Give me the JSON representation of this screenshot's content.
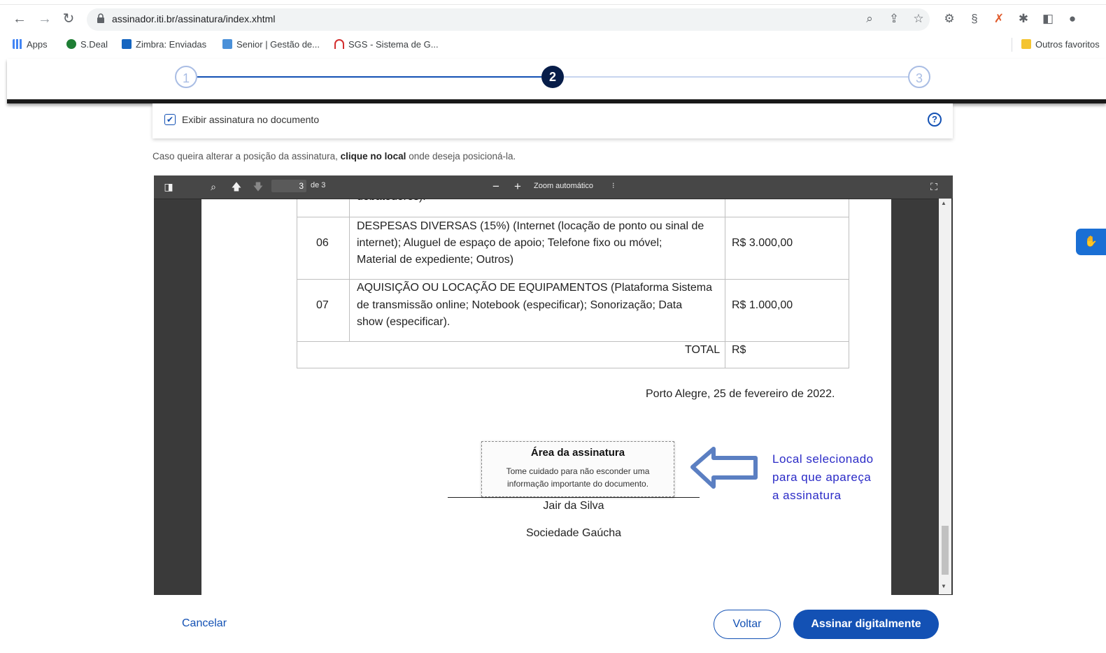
{
  "browser": {
    "url": "assinador.iti.br/assinatura/index.xhtml",
    "bookmarks": [
      {
        "label": "Apps",
        "color": "#4285f4"
      },
      {
        "label": "S.Deal",
        "color": "#1e7e34"
      },
      {
        "label": "Zimbra: Enviadas",
        "color": "#1565c0"
      },
      {
        "label": "Senior | Gestão de...",
        "color": "#4a90d9"
      },
      {
        "label": "SGS - Sistema de G...",
        "color": "#d32f2f"
      }
    ],
    "other_bookmarks": "Outros favoritos"
  },
  "stepper": {
    "steps": [
      "1",
      "2",
      "3"
    ],
    "active_step": 2
  },
  "options": {
    "show_signature_label": "Exibir assinatura no documento",
    "show_signature_checked": true,
    "help_glyph": "?"
  },
  "instruction": {
    "prefix": "Caso queira alterar a posição da assinatura, ",
    "bold": "clique no local",
    "suffix": " onde deseja posicioná-la."
  },
  "pdf_viewer": {
    "current_page": "3",
    "page_of": "de 3",
    "zoom": "Zoom automático"
  },
  "document": {
    "cut_off_text": "debatedores).",
    "rows": [
      {
        "num": "06",
        "lines": [
          "DESPESAS DIVERSAS (15%) (Internet (locação de ponto ou sinal de",
          "internet); Aluguel de espaço de apoio; Telefone fixo ou móvel;",
          "Material de expediente; Outros)"
        ],
        "value": "R$ 3.000,00"
      },
      {
        "num": "07",
        "lines": [
          "AQUISIÇÃO OU LOCAÇÃO DE EQUIPAMENTOS (Plataforma Sistema",
          "de transmissão online; Notebook (especificar); Sonorização; Data",
          "show (especificar)."
        ],
        "value": "R$ 1.000,00"
      }
    ],
    "total_label": "TOTAL",
    "total_value": "R$",
    "place_date": "Porto Alegre, 25 de fevereiro de 2022.",
    "signer_name": "Jair da Silva",
    "signer_org": "Sociedade Gaúcha"
  },
  "signature_area": {
    "title": "Área da assinatura",
    "hint": "Tome cuidado para não esconder uma informação importante do documento."
  },
  "annotation": {
    "lines": [
      "Local selecionado",
      "para que apareça",
      "a assinatura"
    ],
    "color": "#2b2bc7"
  },
  "footer": {
    "cancel": "Cancelar",
    "back": "Voltar",
    "sign": "Assinar digitalmente"
  },
  "colors": {
    "primary": "#1351b4",
    "stepper_active": "#071d49"
  }
}
